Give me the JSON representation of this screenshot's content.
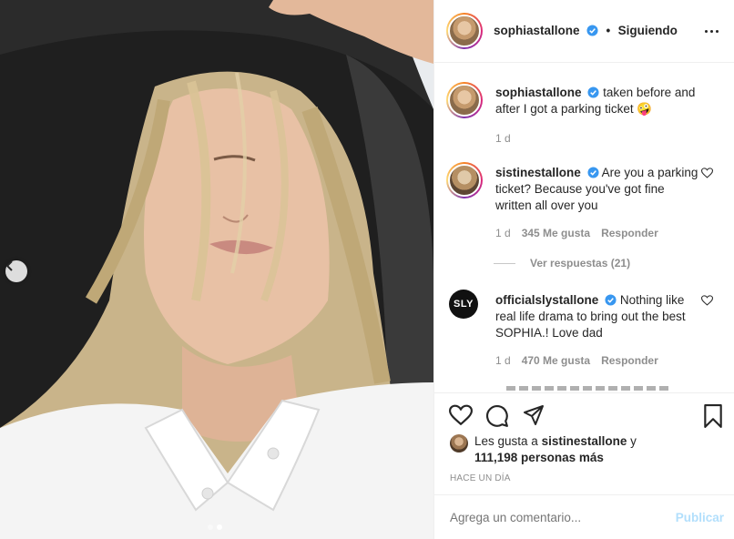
{
  "post": {
    "author": "sophiastallone",
    "follow_sep": "•",
    "follow_label": "Siguiendo",
    "caption": "taken before and after I got a parking ticket 🤪",
    "caption_time": "1 d"
  },
  "comments": [
    {
      "user": "sistinestallone",
      "text": "Are you a parking ticket? Because you've got fine written all over you",
      "time": "1 d",
      "likes": "345 Me gusta",
      "reply": "Responder",
      "view_replies": "Ver respuestas (21)"
    },
    {
      "user": "officialslystallone",
      "avatar_text": "SLY",
      "text": "Nothing like real life drama to bring out the best SOPHIA.! Love dad",
      "time": "1 d",
      "likes": "470 Me gusta",
      "reply": "Responder"
    }
  ],
  "likes": {
    "prefix": "Les gusta a",
    "user": "sistinestallone",
    "and": "y",
    "others": "111,198 personas más"
  },
  "date": "HACE UN DÍA",
  "comment_box": {
    "placeholder": "Agrega un comentario...",
    "publish": "Publicar"
  },
  "icons": [
    "heart-icon",
    "comment-icon",
    "share-icon",
    "bookmark-icon",
    "more-options-icon",
    "verified-badge-icon",
    "chevron-left-icon"
  ],
  "colors": {
    "verified": "#3897f0",
    "publish_disabled": "#b2dffc",
    "muted": "#8e8e8e"
  }
}
